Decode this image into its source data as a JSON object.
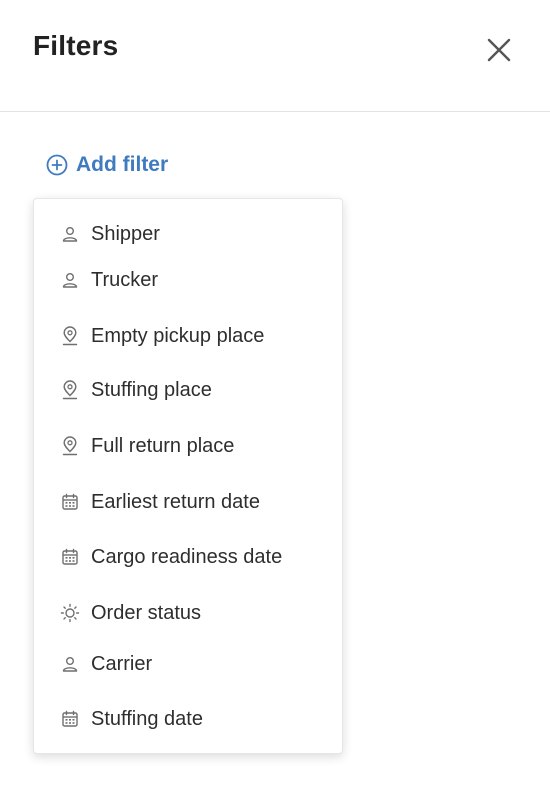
{
  "header": {
    "title": "Filters"
  },
  "add_filter": {
    "label": "Add filter"
  },
  "dropdown": {
    "items": [
      {
        "label": "Shipper",
        "icon": "person-icon"
      },
      {
        "label": "Trucker",
        "icon": "person-icon"
      },
      {
        "label": "Empty pickup place",
        "icon": "location-pin-icon"
      },
      {
        "label": "Stuffing place",
        "icon": "location-pin-icon"
      },
      {
        "label": "Full return place",
        "icon": "location-pin-icon"
      },
      {
        "label": "Earliest return date",
        "icon": "calendar-icon"
      },
      {
        "label": "Cargo readiness date",
        "icon": "calendar-icon"
      },
      {
        "label": "Order status",
        "icon": "sun-icon"
      },
      {
        "label": "Carrier",
        "icon": "person-icon"
      },
      {
        "label": "Stuffing date",
        "icon": "calendar-icon"
      }
    ]
  },
  "colors": {
    "accent": "#3f7bbf",
    "text": "#2e2e2e",
    "icon": "#6f6f6f"
  }
}
